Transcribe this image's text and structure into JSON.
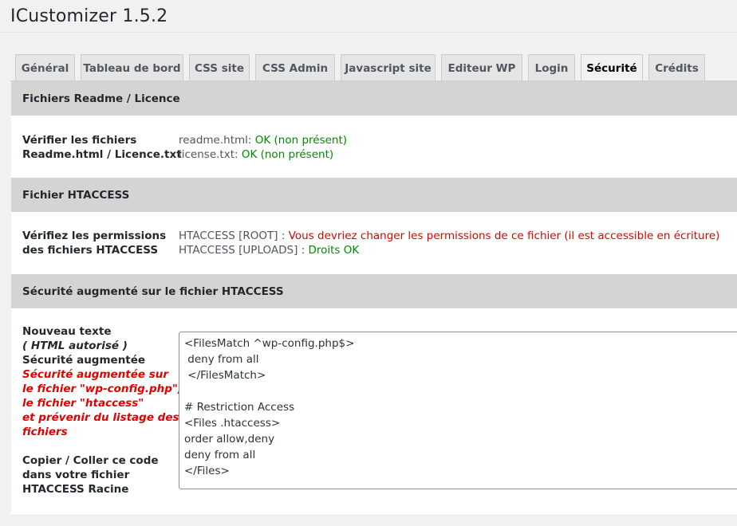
{
  "app": {
    "title": "ICustomizer 1.5.2"
  },
  "tabs": [
    {
      "label": "Général"
    },
    {
      "label": "Tableau de bord"
    },
    {
      "label": "CSS site"
    },
    {
      "label": "CSS Admin"
    },
    {
      "label": "Javascript site"
    },
    {
      "label": "Editeur WP"
    },
    {
      "label": "Login"
    },
    {
      "label": "Sécurité"
    },
    {
      "label": "Crédits"
    }
  ],
  "active_tab": "Sécurité",
  "sections": {
    "readme": {
      "title": "Fichiers Readme / Licence",
      "label_line1": "Vérifier les fichiers",
      "label_line2": "Readme.html / Licence.txt",
      "readme_file": "readme.html:",
      "readme_status": "OK (non présent)",
      "license_file": "license.txt:",
      "license_status": "OK (non présent)"
    },
    "htaccess": {
      "title": "Fichier HTACCESS",
      "label_line1": "Vérifiez les permissions",
      "label_line2": "des fichiers HTACCESS",
      "root_file": "HTACCESS [ROOT] :",
      "root_status": "Vous devriez changer les permissions de ce fichier (il est accessible en écriture)",
      "uploads_file": "HTACCESS [UPLOADS] :",
      "uploads_status": "Droits OK"
    },
    "security": {
      "title": "Sécurité augmenté sur le fichier HTACCESS",
      "label_line1": "Nouveau texte",
      "label_line2": "( HTML autorisé )",
      "label_line3": "Sécurité augmentée",
      "red_line1": "Sécurité augmentée sur",
      "red_line2": "le fichier \"wp-config.php\",",
      "red_line3": "le fichier \"htaccess\"",
      "red_line4": "et prévenir du listage des",
      "red_line5": "fichiers",
      "copy_line1": "Copier / Coller ce code",
      "copy_line2": "dans votre fichier",
      "copy_line3": "HTACCESS Racine",
      "code": "<FilesMatch ^wp-config.php$>\n deny from all\n </FilesMatch>\n\n# Restriction Access\n<Files .htaccess>\norder allow,deny\ndeny from all\n</Files>"
    }
  },
  "colors": {
    "ok": "#008a00",
    "warning": "#e30000",
    "section_header_bg": "#d4d4d4",
    "page_bg": "#f1f1f1"
  }
}
